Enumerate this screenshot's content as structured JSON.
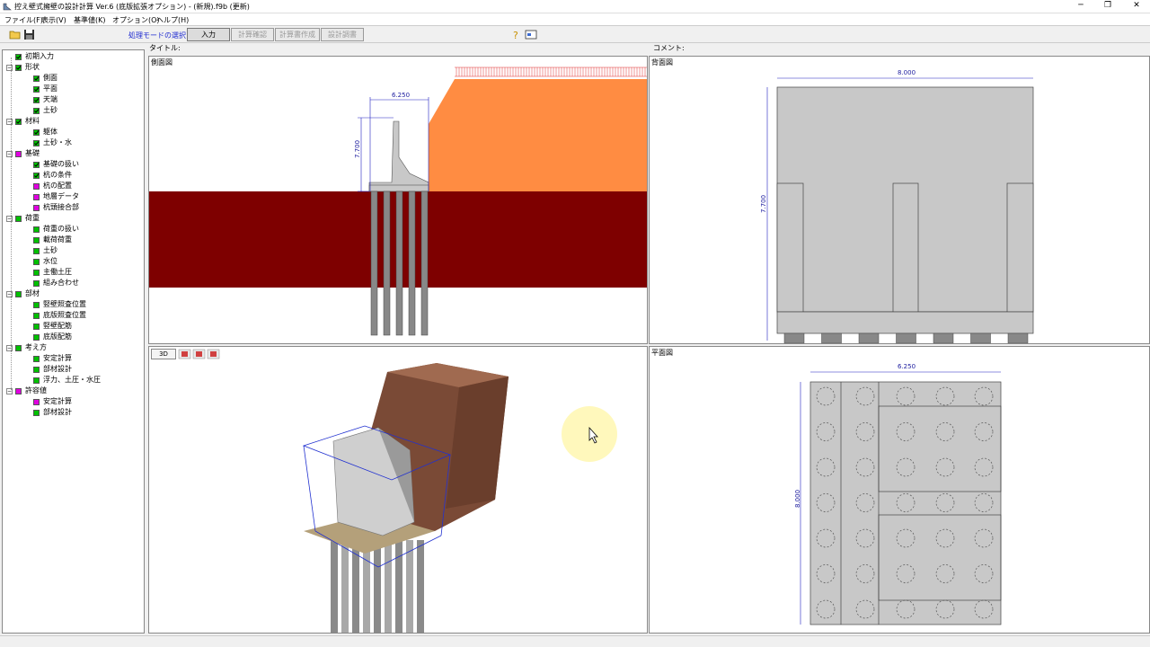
{
  "window": {
    "title": "控え壁式擁壁の設計計算 Ver.6 (底版拡張オプション) - (新規).f9b (更新)",
    "minimize": "─",
    "restore": "❐",
    "close": "✕"
  },
  "menu": [
    "ファイル(F)",
    "表示(V)",
    "基準値(K)",
    "オプション(O)",
    "ヘルプ(H)"
  ],
  "toolbar": {
    "mode_label": "処理モードの選択",
    "modes": [
      "入力",
      "計算確認",
      "計算書作成",
      "設計調書"
    ],
    "active_mode": "入力"
  },
  "headers": {
    "title_label": "タイトル:",
    "comment_label": "コメント:"
  },
  "panes": {
    "side": "側面図",
    "front": "背面図",
    "plan": "平面図",
    "view3d_button": "3D"
  },
  "dimensions": {
    "side_width": "6.250",
    "side_height": "7.700",
    "front_width": "8.000",
    "front_height": "7.700",
    "plan_width": "6.250",
    "plan_height": "8.000"
  },
  "tree": [
    {
      "label": "初期入力",
      "level": 0,
      "check": "green-check",
      "expandable": false
    },
    {
      "label": "形状",
      "level": 0,
      "check": "green-check",
      "expandable": true
    },
    {
      "label": "側面",
      "level": 1,
      "check": "green-check"
    },
    {
      "label": "平面",
      "level": 1,
      "check": "green-check"
    },
    {
      "label": "天端",
      "level": 1,
      "check": "green-check"
    },
    {
      "label": "土砂",
      "level": 1,
      "check": "green-check"
    },
    {
      "label": "材料",
      "level": 0,
      "check": "green-check",
      "expandable": true
    },
    {
      "label": "躯体",
      "level": 1,
      "check": "green-check"
    },
    {
      "label": "土砂・水",
      "level": 1,
      "check": "green-check"
    },
    {
      "label": "基礎",
      "level": 0,
      "check": "magenta",
      "expandable": true
    },
    {
      "label": "基礎の扱い",
      "level": 1,
      "check": "green-check"
    },
    {
      "label": "杭の条件",
      "level": 1,
      "check": "green-check"
    },
    {
      "label": "杭の配置",
      "level": 1,
      "check": "magenta"
    },
    {
      "label": "地層データ",
      "level": 1,
      "check": "magenta"
    },
    {
      "label": "杭頭接合部",
      "level": 1,
      "check": "magenta"
    },
    {
      "label": "荷重",
      "level": 0,
      "check": "green",
      "expandable": true
    },
    {
      "label": "荷重の扱い",
      "level": 1,
      "check": "green"
    },
    {
      "label": "載荷荷重",
      "level": 1,
      "check": "green"
    },
    {
      "label": "土砂",
      "level": 1,
      "check": "green"
    },
    {
      "label": "水位",
      "level": 1,
      "check": "green"
    },
    {
      "label": "主働土圧",
      "level": 1,
      "check": "green"
    },
    {
      "label": "組み合わせ",
      "level": 1,
      "check": "green"
    },
    {
      "label": "部材",
      "level": 0,
      "check": "green",
      "expandable": true
    },
    {
      "label": "竪壁照査位置",
      "level": 1,
      "check": "green"
    },
    {
      "label": "底版照査位置",
      "level": 1,
      "check": "green"
    },
    {
      "label": "竪壁配筋",
      "level": 1,
      "check": "green"
    },
    {
      "label": "底版配筋",
      "level": 1,
      "check": "green"
    },
    {
      "label": "考え方",
      "level": 0,
      "check": "green",
      "expandable": true
    },
    {
      "label": "安定計算",
      "level": 1,
      "check": "green"
    },
    {
      "label": "部材設計",
      "level": 1,
      "check": "green"
    },
    {
      "label": "浮力、土圧・水圧",
      "level": 1,
      "check": "green"
    },
    {
      "label": "許容値",
      "level": 0,
      "check": "magenta",
      "expandable": true
    },
    {
      "label": "安定計算",
      "level": 1,
      "check": "magenta"
    },
    {
      "label": "部材設計",
      "level": 1,
      "check": "green"
    }
  ],
  "colors": {
    "green": "#00c000",
    "magenta": "#e000e0",
    "backfill": "#ff8c42",
    "ground": "#7e0000",
    "concrete": "#c8c8c8",
    "dim_line": "#2020c0"
  }
}
